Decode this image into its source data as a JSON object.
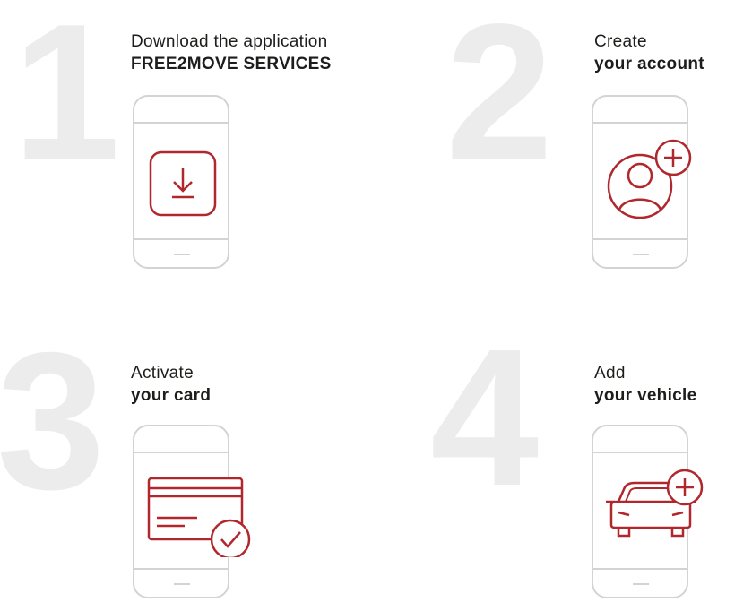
{
  "accent_color": "#b0272d",
  "step_number_color": "#ececec",
  "steps": [
    {
      "number": "1",
      "line1": "Download the application",
      "line2": "FREE2MOVE SERVICES",
      "icon": "download-icon"
    },
    {
      "number": "2",
      "line1": "Create",
      "line2": "your account",
      "icon": "user-add-icon"
    },
    {
      "number": "3",
      "line1": "Activate",
      "line2": "your card",
      "icon": "card-check-icon"
    },
    {
      "number": "4",
      "line1": "Add",
      "line2": "your vehicle",
      "icon": "car-add-icon"
    }
  ]
}
